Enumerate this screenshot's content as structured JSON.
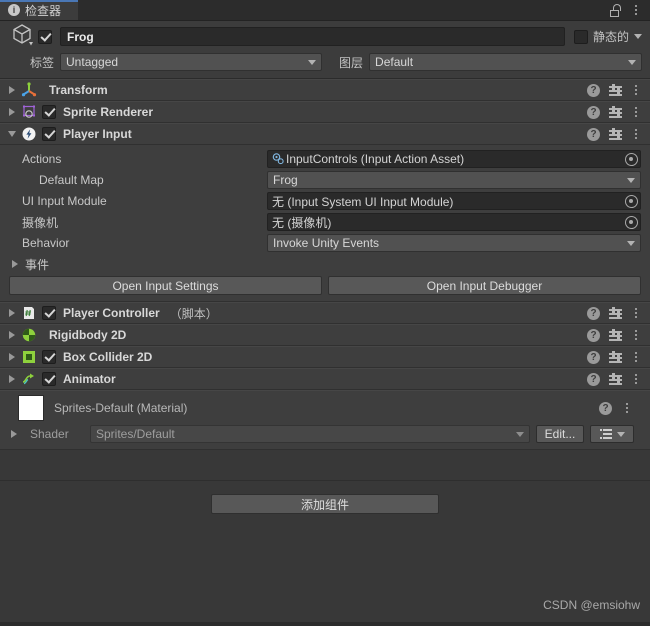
{
  "window": {
    "tab_label": "检查器",
    "tab_icon": "info-icon",
    "lock_icon": "lock-open-icon",
    "menu_icon": "kebab-menu-icon"
  },
  "gameobject": {
    "icon": "gameobject-cube-icon",
    "enabled": true,
    "name": "Frog",
    "static_label": "静态的",
    "static_checked": false,
    "tag_label": "标签",
    "tag_value": "Untagged",
    "layer_label": "图层",
    "layer_value": "Default"
  },
  "components": [
    {
      "name": "Transform",
      "suffix": "",
      "icon": "transform-axis-icon",
      "has_checkbox": false,
      "enabled": false,
      "expanded": false
    },
    {
      "name": "Sprite Renderer",
      "suffix": "",
      "icon": "sprite-renderer-icon",
      "has_checkbox": true,
      "enabled": true,
      "expanded": false
    },
    {
      "name": "Player Input",
      "suffix": "",
      "icon": "player-input-icon",
      "has_checkbox": true,
      "enabled": true,
      "expanded": true
    }
  ],
  "player_input": {
    "properties": [
      {
        "label": "Actions",
        "indent": false,
        "kind": "object",
        "value": "InputControls (Input Action Asset)",
        "value_icon": "input-action-asset-icon"
      },
      {
        "label": "Default Map",
        "indent": true,
        "kind": "popup",
        "value": "Frog",
        "value_icon": ""
      },
      {
        "label": "UI Input Module",
        "indent": false,
        "kind": "object",
        "value": "无 (Input System UI Input Module)",
        "value_icon": ""
      },
      {
        "label": "摄像机",
        "indent": false,
        "kind": "object",
        "value": "无 (摄像机)",
        "value_icon": ""
      },
      {
        "label": "Behavior",
        "indent": false,
        "kind": "popup",
        "value": "Invoke Unity Events",
        "value_icon": ""
      }
    ],
    "events_label": "事件",
    "events_expanded": false,
    "buttons": [
      "Open Input Settings",
      "Open Input Debugger"
    ]
  },
  "components_lower": [
    {
      "name": "Player Controller",
      "suffix": "（脚本）",
      "icon": "script-icon",
      "has_checkbox": true,
      "enabled": true,
      "expanded": false
    },
    {
      "name": "Rigidbody 2D",
      "suffix": "",
      "icon": "rigidbody2d-icon",
      "has_checkbox": false,
      "enabled": false,
      "expanded": false
    },
    {
      "name": "Box Collider 2D",
      "suffix": "",
      "icon": "box-collider-2d-icon",
      "has_checkbox": true,
      "enabled": true,
      "expanded": false
    },
    {
      "name": "Animator",
      "suffix": "",
      "icon": "animator-icon",
      "has_checkbox": true,
      "enabled": true,
      "expanded": false
    }
  ],
  "material": {
    "title": "Sprites-Default (Material)",
    "swatch_color": "#ffffff",
    "shader_label": "Shader",
    "shader_value": "Sprites/Default",
    "edit_label": "Edit...",
    "preset_icon": "preset-list-icon"
  },
  "footer": {
    "add_component_label": "添加组件",
    "watermark": "CSDN @emsiohw"
  },
  "icons": {
    "help": "?",
    "info": "i",
    "settings": "preset-settings-icon",
    "menu": "kebab-menu-icon",
    "object_picker": "object-picker-icon",
    "dropdown": "chevron-down-icon"
  },
  "colors": {
    "window_bg": "#383838",
    "panel_bg": "#3e3e3e",
    "tab_bg": "#3c3c3c",
    "tab_accent": "#4a77b5",
    "field_bg": "#2a2a2a",
    "popup_bg": "#515151",
    "button_bg": "#585858",
    "text": "#c8c8c8",
    "unity_green": "#8ed13d",
    "sprite_purple": "#a064d8"
  }
}
